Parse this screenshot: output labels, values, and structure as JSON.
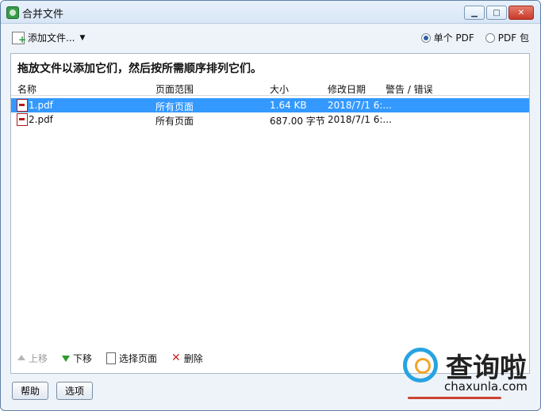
{
  "window": {
    "title": "合并文件"
  },
  "toolbar": {
    "add_files_label": "添加文件...",
    "single_pdf_label": "单个 PDF",
    "pdf_package_label": "PDF 包"
  },
  "instruction": "拖放文件以添加它们，然后按所需顺序排列它们。",
  "columns": [
    "名称",
    "页面范围",
    "大小",
    "修改日期",
    "警告 / 错误"
  ],
  "rows": [
    {
      "name": "1.pdf",
      "range": "所有页面",
      "size": "1.64 KB",
      "modified": "2018/7/1 6:...",
      "warning": ""
    },
    {
      "name": "2.pdf",
      "range": "所有页面",
      "size": "687.00 字节",
      "modified": "2018/7/1 6:...",
      "warning": ""
    }
  ],
  "actions": {
    "up": "上移",
    "down": "下移",
    "choose_pages": "选择页面",
    "delete": "删除"
  },
  "footer": {
    "help": "帮助",
    "options": "选项"
  },
  "watermark": {
    "text": "查询啦",
    "sub": "chaxunla.com"
  }
}
